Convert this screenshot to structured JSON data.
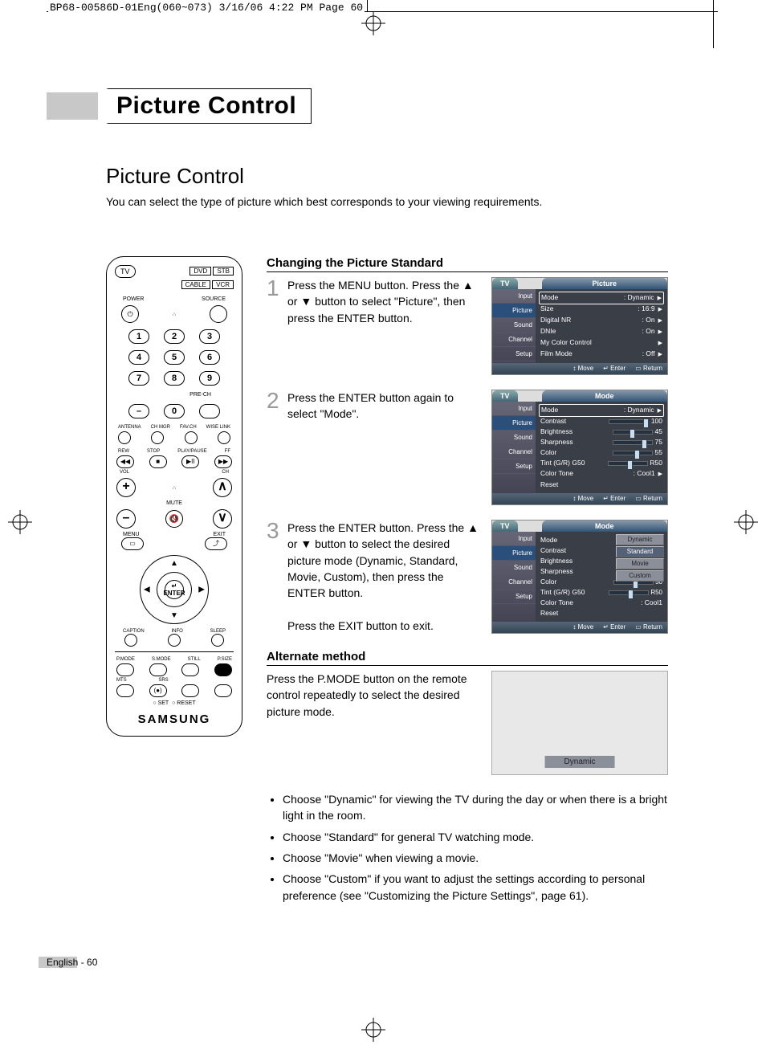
{
  "header_slug": "BP68-00586D-01Eng(060~073)  3/16/06  4:22 PM  Page 60",
  "title": "Picture Control",
  "subtitle": "Picture Control",
  "intro": "You can select the type of picture which best corresponds to your viewing requirements.",
  "remote": {
    "tv": "TV",
    "dvd": "DVD",
    "stb": "STB",
    "cable": "CABLE",
    "vcr": "VCR",
    "power": "POWER",
    "source": "SOURCE",
    "prech": "PRE-CH",
    "lbl4": [
      "ANTENNA",
      "CH MGR",
      "FAV.CH",
      "WISE LINK"
    ],
    "transport": [
      "REW",
      "STOP",
      "PLAY/PAUSE",
      "FF"
    ],
    "mute": "MUTE",
    "vol": "VOL",
    "ch": "CH",
    "menu": "MENU",
    "exit": "EXIT",
    "enter": "ENTER",
    "row3": [
      "CAPTION",
      "INFO",
      "SLEEP"
    ],
    "row4": [
      "P.MODE",
      "S.MODE",
      "STILL",
      "P.SIZE"
    ],
    "row5": [
      "MTS",
      "SRS",
      "",
      ""
    ],
    "setreset": [
      "SET",
      "RESET"
    ],
    "brand": "SAMSUNG"
  },
  "sect1": "Changing the Picture Standard",
  "steps": [
    {
      "n": "1",
      "txt": "Press the MENU button. Press the ▲ or ▼ button to select \"Picture\", then press the ENTER button."
    },
    {
      "n": "2",
      "txt": "Press the ENTER button again to select \"Mode\"."
    },
    {
      "n": "3",
      "txt": "Press the ENTER button. Press the ▲ or ▼ button to select the desired picture mode (Dynamic, Standard, Movie, Custom), then press the ENTER button.",
      "extra": "Press the EXIT button to exit."
    }
  ],
  "osd1": {
    "tv": "TV",
    "title": "Picture",
    "side": [
      "Input",
      "Picture",
      "Sound",
      "Channel",
      "Setup"
    ],
    "rows": [
      [
        "Mode",
        ": Dynamic",
        "▶"
      ],
      [
        "Size",
        ": 16:9",
        "▶"
      ],
      [
        "Digital NR",
        ": On",
        "▶"
      ],
      [
        "DNIe",
        ": On",
        "▶"
      ],
      [
        "My Color Control",
        "",
        "▶"
      ],
      [
        "Film Mode",
        ": Off",
        "▶"
      ]
    ],
    "foot": [
      "Move",
      "Enter",
      "Return"
    ]
  },
  "osd2": {
    "tv": "TV",
    "title": "Mode",
    "side": [
      "Input",
      "Picture",
      "Sound",
      "Channel",
      "Setup"
    ],
    "rows": [
      [
        "Mode",
        ": Dynamic",
        "▶"
      ],
      [
        "Contrast",
        "slider",
        "100",
        "s100"
      ],
      [
        "Brightness",
        "slider",
        "45",
        "s45"
      ],
      [
        "Sharpness",
        "slider",
        "75",
        "s75"
      ],
      [
        "Color",
        "slider",
        "55",
        "s55"
      ],
      [
        "Tint (G/R)",
        "tint",
        "R50"
      ],
      [
        "Color Tone",
        ": Cool1",
        "▶"
      ],
      [
        "Reset",
        "",
        ""
      ]
    ],
    "gleft": "G50",
    "foot": [
      "Move",
      "Enter",
      "Return"
    ]
  },
  "osd3": {
    "tv": "TV",
    "title": "Mode",
    "side": [
      "Input",
      "Picture",
      "Sound",
      "Channel",
      "Setup"
    ],
    "left_rows": [
      "Mode",
      "Contrast",
      "Brightness",
      "Sharpness",
      "Color",
      "Tint (G/R)",
      "Color Tone",
      "Reset"
    ],
    "dropdown": [
      "Dynamic",
      "Standard",
      "Movie",
      "Custom"
    ],
    "color": "50",
    "tint": "R50",
    "colortone": ": Cool1",
    "gleft": "G50",
    "foot": [
      "Move",
      "Enter",
      "Return"
    ]
  },
  "sect2": "Alternate method",
  "alt_txt": "Press the P.MODE button on the remote control repeatedly to select the desired picture mode.",
  "osd4_label": "Dynamic",
  "bullets": [
    "Choose \"Dynamic\" for viewing the TV during the day or when there is a bright light in the room.",
    "Choose \"Standard\" for general TV watching mode.",
    "Choose \"Movie\" when viewing a movie.",
    "Choose \"Custom\" if you want to adjust the settings according to personal preference (see \"Customizing the Picture Settings\", page 61)."
  ],
  "footer": "English - 60"
}
